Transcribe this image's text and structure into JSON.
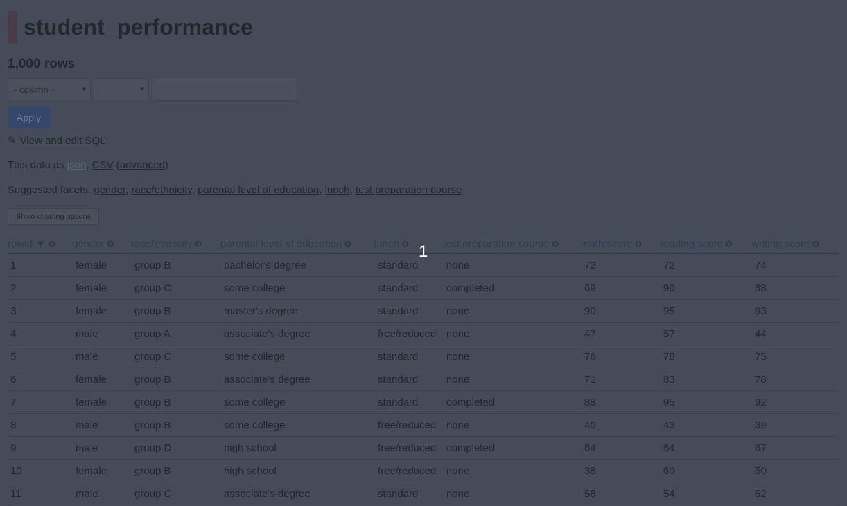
{
  "page": {
    "title": "student_performance",
    "row_count": "1,000 rows",
    "filter": {
      "column_placeholder": "- column -",
      "operator": "=",
      "value": "",
      "dropdown_arrow": "▾"
    },
    "apply_label": "Apply",
    "sql": {
      "pencil": "✎",
      "link": "View and edit SQL"
    },
    "export": {
      "prefix": "This data as ",
      "json": "json",
      "sep1": ", ",
      "csv": "CSV",
      "paren_open": " (",
      "advanced": "advanced",
      "paren_close": ")"
    },
    "facets": {
      "prefix": "Suggested facets: ",
      "items": [
        "gender",
        "race/ethnicity",
        "parental level of education",
        "lunch",
        "test preparation course"
      ],
      "sep": ", "
    },
    "chart_button": "Show charting options",
    "overlay_number": "1"
  },
  "table": {
    "sort_indicator": "▼",
    "gear": "⚙",
    "columns": [
      "rowid",
      "gender",
      "race/ethnicity",
      "parental level of education",
      "lunch",
      "test preparation course",
      "math score",
      "reading score",
      "writing score"
    ],
    "rows": [
      [
        "1",
        "female",
        "group B",
        "bachelor's degree",
        "standard",
        "none",
        "72",
        "72",
        "74"
      ],
      [
        "2",
        "female",
        "group C",
        "some college",
        "standard",
        "completed",
        "69",
        "90",
        "88"
      ],
      [
        "3",
        "female",
        "group B",
        "master's degree",
        "standard",
        "none",
        "90",
        "95",
        "93"
      ],
      [
        "4",
        "male",
        "group A",
        "associate's degree",
        "free/reduced",
        "none",
        "47",
        "57",
        "44"
      ],
      [
        "5",
        "male",
        "group C",
        "some college",
        "standard",
        "none",
        "76",
        "78",
        "75"
      ],
      [
        "6",
        "female",
        "group B",
        "associate's degree",
        "standard",
        "none",
        "71",
        "83",
        "78"
      ],
      [
        "7",
        "female",
        "group B",
        "some college",
        "standard",
        "completed",
        "88",
        "95",
        "92"
      ],
      [
        "8",
        "male",
        "group B",
        "some college",
        "free/reduced",
        "none",
        "40",
        "43",
        "39"
      ],
      [
        "9",
        "male",
        "group D",
        "high school",
        "free/reduced",
        "completed",
        "64",
        "64",
        "67"
      ],
      [
        "10",
        "female",
        "group B",
        "high school",
        "free/reduced",
        "none",
        "38",
        "60",
        "50"
      ],
      [
        "11",
        "male",
        "group C",
        "associate's degree",
        "standard",
        "none",
        "58",
        "54",
        "52"
      ]
    ]
  }
}
